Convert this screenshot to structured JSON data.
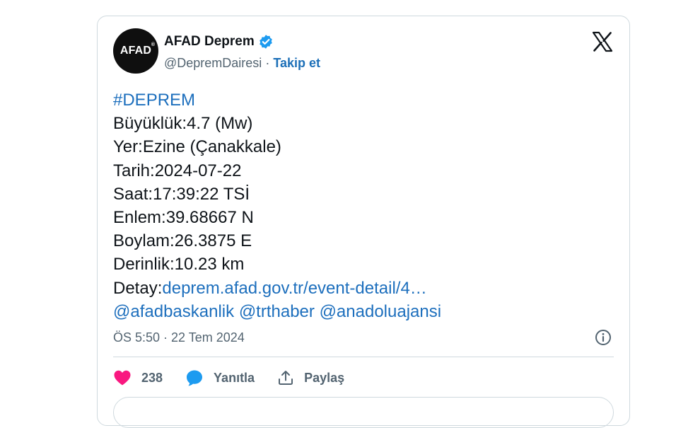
{
  "tweet": {
    "author_name": "AFAD Deprem",
    "avatar_text": "AFAD",
    "avatar_mark": "®",
    "handle": "@DepremDairesi",
    "separator": " · ",
    "follow_label": "Takip et",
    "hashtag": "#DEPREM",
    "lines": [
      "Büyüklük:4.7 (Mw)",
      "Yer:Ezine (Çanakkale)",
      "Tarih:2024-07-22",
      "Saat:17:39:22 TSİ",
      "Enlem:39.68667 N",
      "Boylam:26.3875 E",
      "Derinlik:10.23 km"
    ],
    "detail_label": "Detay:",
    "detail_link": "deprem.afad.gov.tr/event-detail/4…",
    "mentions": [
      "@afadbaskanlik",
      "@trthaber",
      "@anadoluajansi"
    ],
    "timestamp": "ÖS 5:50 · 22 Tem 2024",
    "like_count": "238",
    "reply_label": "Yanıtla",
    "share_label": "Paylaş"
  },
  "colors": {
    "link": "#1d6fbd",
    "verified": "#1d9bf0",
    "like": "#f91880",
    "reply": "#1d9bf0"
  },
  "icons": [
    "verified-badge-icon",
    "x-logo-icon",
    "info-icon",
    "heart-icon",
    "reply-bubble-icon",
    "share-icon"
  ]
}
